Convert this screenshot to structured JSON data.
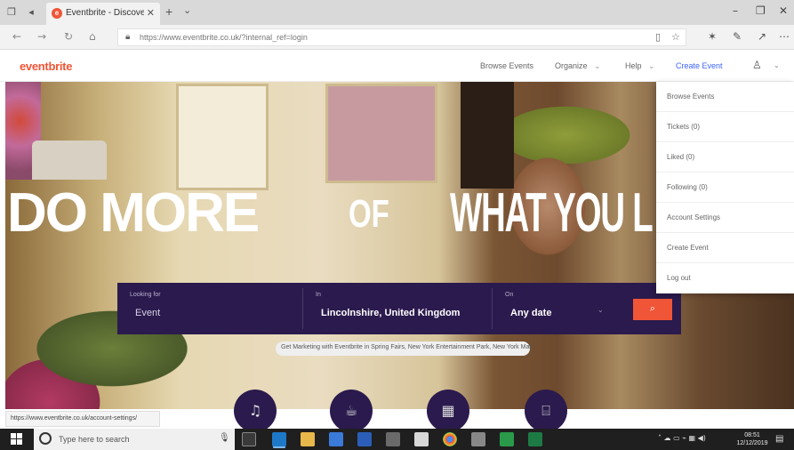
{
  "browser": {
    "tab_title": "Eventbrite - Discover G",
    "url": "https://www.eventbrite.co.uk/?internal_ref=login",
    "status_url": "https://www.eventbrite.co.uk/account-settings/"
  },
  "header": {
    "logo": "eventbrite",
    "nav": {
      "browse_events": "Browse Events",
      "organize": "Organize",
      "help": "Help",
      "create_event": "Create Event"
    }
  },
  "hero": {
    "headline_part1": "DO MORE",
    "headline_part2": "OF",
    "headline_part3": "WHAT YOU L",
    "search": {
      "looking_for_label": "Looking for",
      "looking_for_value": "Event",
      "in_label": "In",
      "in_value": "Lincolnshire, United Kingdom",
      "on_label": "On",
      "on_value": "Any date",
      "button_icon": "search-icon"
    },
    "promo": "Get Marketing with Eventbrite in Spring Fairs, New York Entertainment Park, New York Mall",
    "categories": [
      "music-icon",
      "food-icon",
      "calendar-icon",
      "gift-icon"
    ]
  },
  "dropdown": {
    "items": [
      "Browse Events",
      "Tickets (0)",
      "Liked (0)",
      "Following (0)",
      "Account Settings",
      "Create Event",
      "Log out"
    ]
  },
  "taskbar": {
    "search_placeholder": "Type here to search",
    "time": "08:51",
    "date": "12/12/2019"
  },
  "colors": {
    "brand": "#f05537",
    "search_bar": "#2b1a4d",
    "link": "#3d64ff"
  }
}
